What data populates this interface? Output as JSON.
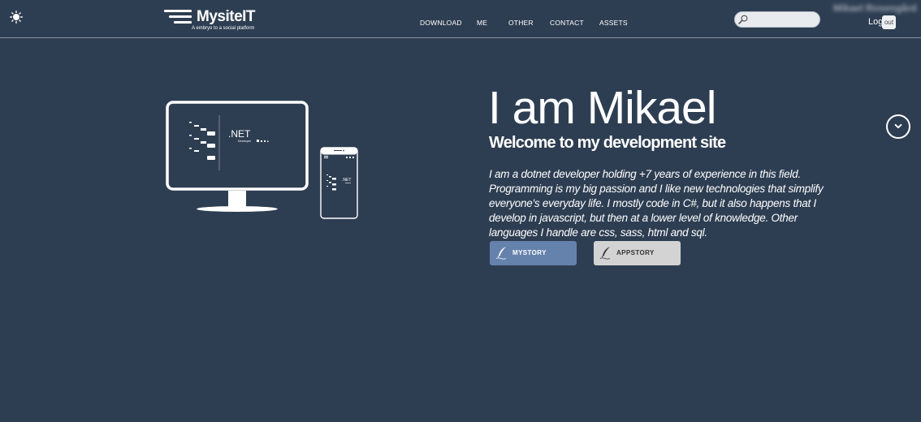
{
  "header": {
    "logo": {
      "brand": "MysiteIT",
      "tagline": "A embryo to a social platform"
    },
    "nav": [
      {
        "label": "DOWNLOAD"
      },
      {
        "label": "ME"
      },
      {
        "label": "OTHER"
      },
      {
        "label": "CONTACT"
      },
      {
        "label": "ASSETS"
      }
    ],
    "search": {
      "value": "",
      "placeholder": ""
    },
    "user": {
      "name": "Mikael Rosengård",
      "log_label": "Log",
      "logout_label": "out"
    }
  },
  "hero": {
    "title": "I am Mikael",
    "subtitle": "Welcome to my development site",
    "text": "I am a dotnet developer holding +7 years of experience in this field. Programming is my big passion and I like new technologies that simplify everyone's everyday life. I mostly code in C#, but it also happens that I develop in javascript, but then at a lower level of knowledge. Other languages I handle are css, sass, html and sql.",
    "buttons": [
      {
        "label": "MYSTORY"
      },
      {
        "label": "APPSTORY"
      }
    ]
  },
  "illustration": {
    "monitor_text": ".NET",
    "monitor_subtext": "Developer",
    "phone_text": ".NET"
  },
  "colors": {
    "background": "#2e3e52",
    "mystory_button": "#6582ad",
    "appstory_button": "#d3d3d3"
  },
  "icons": {
    "theme": "sun-icon",
    "search": "magnifier-icon",
    "button": "quill-icon",
    "scroll": "chevron-down-icon"
  }
}
